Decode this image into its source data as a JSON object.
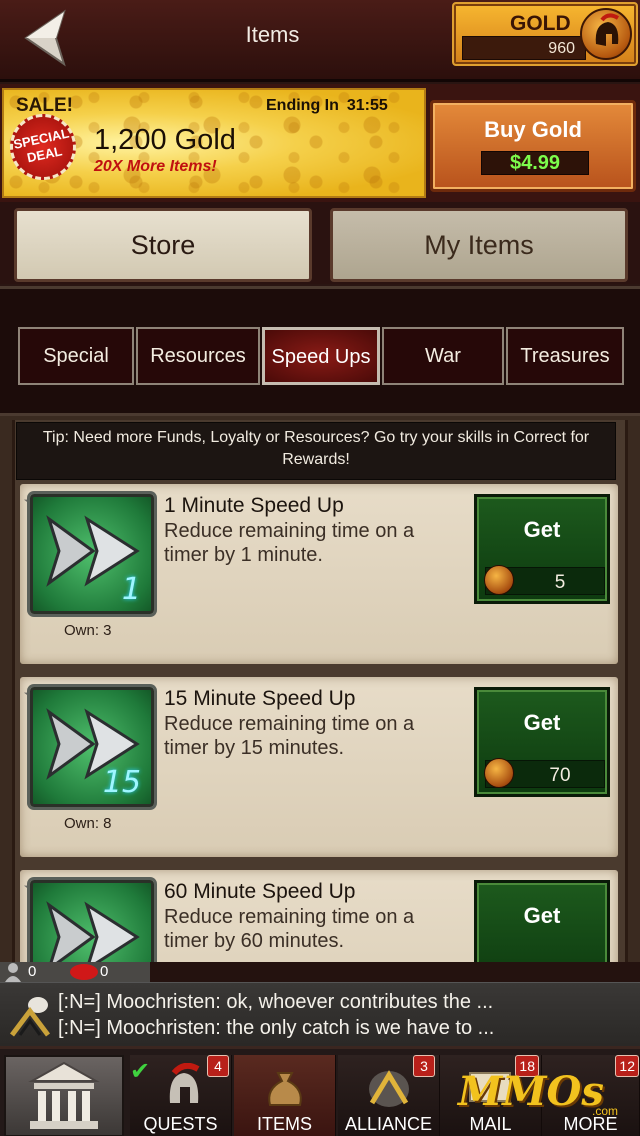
{
  "header": {
    "title": "Items",
    "gold_label": "GOLD",
    "gold_value": "960"
  },
  "sale": {
    "tag": "SALE!",
    "ending_label": "Ending In",
    "ending_time": "31:55",
    "badge": "SPECIAL DEAL",
    "amount": "1,200 Gold",
    "subtitle": "20X More Items!",
    "buy_label": "Buy Gold",
    "price": "$4.99"
  },
  "main_tabs": [
    {
      "label": "Store"
    },
    {
      "label": "My Items"
    }
  ],
  "category_tabs": [
    {
      "label": "Special"
    },
    {
      "label": "Resources"
    },
    {
      "label": "Speed Ups"
    },
    {
      "label": "War"
    },
    {
      "label": "Treasures"
    }
  ],
  "active_category": "Speed Ups",
  "tip": "Tip: Need more Funds, Loyalty or Resources? Go try your skills in Correct for Rewards!",
  "items": [
    {
      "name": "1 Minute Speed Up",
      "desc": "Reduce remaining time on a timer by 1 minute.",
      "own": "Own: 3",
      "icon_number": "1",
      "get_label": "Get",
      "cost": "5"
    },
    {
      "name": "15 Minute Speed Up",
      "desc": "Reduce remaining time on a timer by 15 minutes.",
      "own": "Own: 8",
      "icon_number": "15",
      "get_label": "Get",
      "cost": "70"
    },
    {
      "name": "60 Minute Speed Up",
      "desc": "Reduce remaining time on a timer by 60 minutes.",
      "own": "",
      "icon_number": "",
      "get_label": "Get",
      "cost": ""
    }
  ],
  "status": {
    "players": "0",
    "messages": "0"
  },
  "chat": [
    "[:N=] Moochristen: ok, whoever contributes the ...",
    "[:N=] Moochristen: the only catch is we have to ..."
  ],
  "nav": {
    "quests_label": "QUESTS",
    "quests_badge": "4",
    "items_label": "ITEMS",
    "alliance_label": "ALLIANCE",
    "alliance_badge": "3",
    "mail_label": "MAIL",
    "mail_badge": "18",
    "more_label": "MORE",
    "more_badge": "12"
  },
  "watermark": "MMOs",
  "watermark_suffix": ".com",
  "colors": {
    "price_green": "#7dfc4c",
    "active_tab_red": "#8a1b16",
    "get_button_green": "#1d5a1d",
    "gold": "#f7b730"
  }
}
